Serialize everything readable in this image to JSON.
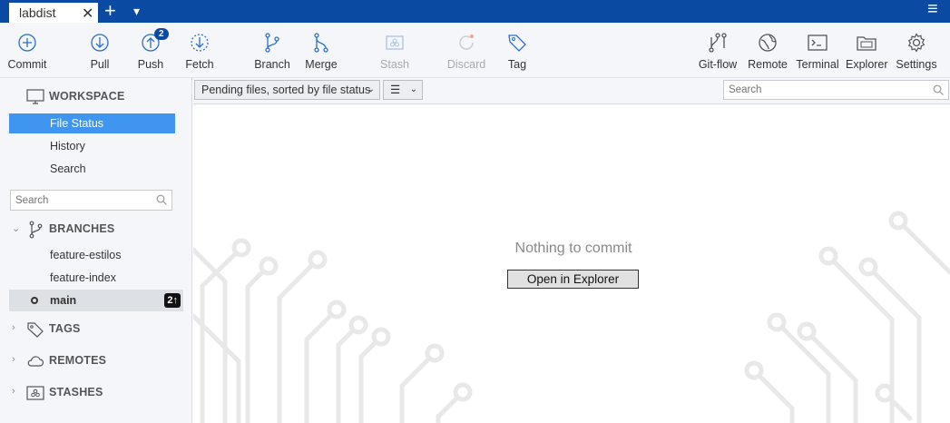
{
  "tab": {
    "title": "labdist",
    "close_glyph": "✕",
    "new_glyph": "+",
    "dropdown_glyph": "▾",
    "menu_glyph": "≡"
  },
  "toolbar": {
    "commit": "Commit",
    "pull": "Pull",
    "push": "Push",
    "push_badge": "2",
    "fetch": "Fetch",
    "branch": "Branch",
    "merge": "Merge",
    "stash": "Stash",
    "discard": "Discard",
    "tag": "Tag",
    "gitflow": "Git-flow",
    "remote": "Remote",
    "terminal": "Terminal",
    "explorer": "Explorer",
    "settings": "Settings"
  },
  "sidebar": {
    "workspace": "WORKSPACE",
    "items": [
      {
        "label": "File Status",
        "active": true
      },
      {
        "label": "History",
        "active": false
      },
      {
        "label": "Search",
        "active": false
      }
    ],
    "search_placeholder": "Search",
    "branches_header": "BRANCHES",
    "branches": [
      {
        "name": "feature-estilos",
        "current": false
      },
      {
        "name": "feature-index",
        "current": false
      },
      {
        "name": "main",
        "current": true,
        "ahead": "2↑"
      }
    ],
    "tags_header": "TAGS",
    "remotes_header": "REMOTES",
    "stashes_header": "STASHES"
  },
  "filterbar": {
    "sort_label": "Pending files, sorted by file status",
    "view_glyph": "☰",
    "search_placeholder": "Search"
  },
  "content": {
    "empty_message": "Nothing to commit",
    "open_button": "Open in Explorer"
  },
  "colors": {
    "accent": "#0b4aa2",
    "selected": "#3f95ef",
    "badge": "#0b4aa2"
  }
}
